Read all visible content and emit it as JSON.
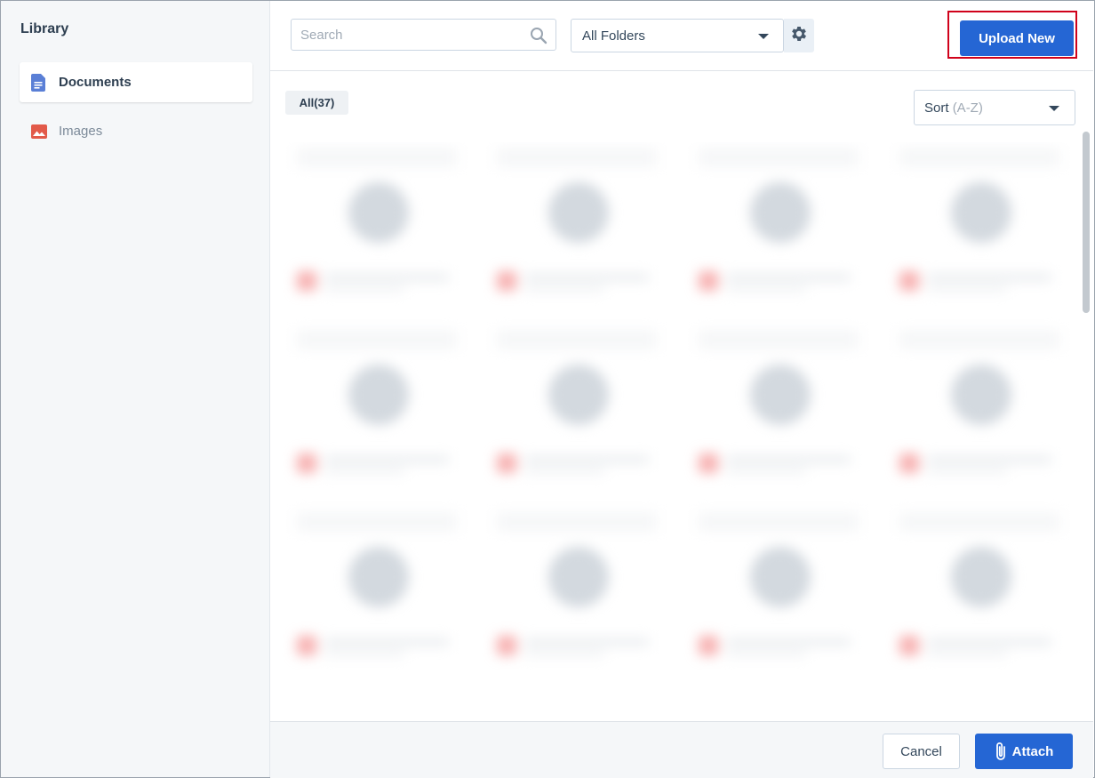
{
  "sidebar": {
    "title": "Library",
    "items": [
      {
        "label": "Documents",
        "icon": "document-icon",
        "active": true
      },
      {
        "label": "Images",
        "icon": "image-icon",
        "active": false
      }
    ]
  },
  "toolbar": {
    "search_placeholder": "Search",
    "folder_select": "All Folders",
    "upload_label": "Upload New"
  },
  "filter": {
    "all_chip": "All(37)",
    "sort_label": "Sort",
    "sort_value": "(A-Z)"
  },
  "footer": {
    "cancel_label": "Cancel",
    "attach_label": "Attach"
  },
  "colors": {
    "primary": "#2566d4",
    "highlight_border": "#d0021b",
    "document_icon": "#5a7fd6",
    "image_icon": "#e25a4a"
  }
}
